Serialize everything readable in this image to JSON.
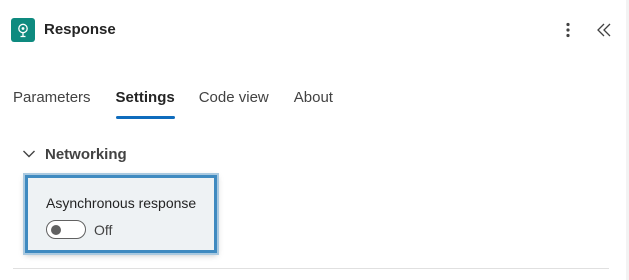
{
  "header": {
    "title": "Response",
    "icon": "response-action-icon",
    "accent_color": "#0e8a7f"
  },
  "tabs": [
    {
      "label": "Parameters",
      "selected": false
    },
    {
      "label": "Settings",
      "selected": true
    },
    {
      "label": "Code view",
      "selected": false
    },
    {
      "label": "About",
      "selected": false
    }
  ],
  "section": {
    "title": "Networking",
    "expanded": true
  },
  "setting": {
    "label": "Asynchronous response",
    "toggle_state": "Off",
    "enabled": false
  },
  "colors": {
    "tab_underline": "#0f6cbd",
    "highlight_border": "#3f8ac0"
  }
}
